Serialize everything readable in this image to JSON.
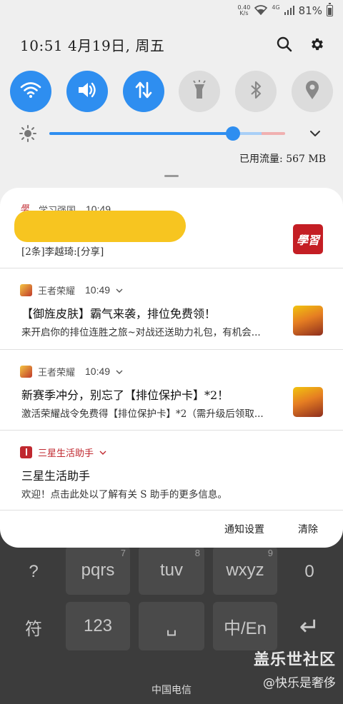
{
  "status_bar": {
    "net_speed_value": "0.40",
    "net_speed_unit": "K/s",
    "network_type": "4G",
    "battery_text": "81%"
  },
  "header": {
    "time_date": "10:51  4月19日, 周五"
  },
  "quick_toggles": [
    {
      "name": "wifi-toggle",
      "icon": "wifi-icon",
      "state": "on"
    },
    {
      "name": "sound-toggle",
      "icon": "speaker-icon",
      "state": "on"
    },
    {
      "name": "mobile-data-toggle",
      "icon": "data-arrows-icon",
      "state": "on"
    },
    {
      "name": "flashlight-toggle",
      "icon": "flashlight-icon",
      "state": "off"
    },
    {
      "name": "bluetooth-toggle",
      "icon": "bluetooth-icon",
      "state": "off"
    },
    {
      "name": "location-toggle",
      "icon": "location-pin-icon",
      "state": "off"
    }
  ],
  "brightness": {
    "level": 0.78
  },
  "data_usage": "已用流量: 567 MB",
  "notifications": [
    {
      "app_name": "学习强国",
      "time": "10:49",
      "title": "",
      "body": "[2条]李越琦:[分享]"
    },
    {
      "app_name": "王者荣耀",
      "time": "10:49",
      "title": "【御旌皮肤】霸气来袭，排位免费领！",
      "body": "来开启你的排位连胜之旅~对战还送助力礼包，有机会..."
    },
    {
      "app_name": "王者荣耀",
      "time": "10:49",
      "title": "新赛季冲分，别忘了【排位保护卡】*2！",
      "body": "激活荣耀战令免费得【排位保护卡】*2（需升级后领取..."
    },
    {
      "app_name": "三星生活助手",
      "time": "",
      "title": "三星生活助手",
      "body": "欢迎！点击此处以了解有关 S 助手的更多信息。"
    }
  ],
  "card_actions": {
    "settings_label": "通知设置",
    "clear_label": "清除"
  },
  "keyboard": {
    "row1": [
      {
        "label": "?",
        "num": ""
      },
      {
        "label": "pqrs",
        "num": "7"
      },
      {
        "label": "tuv",
        "num": "8"
      },
      {
        "label": "wxyz",
        "num": "9"
      },
      {
        "label": "0",
        "num": ""
      }
    ],
    "row2": [
      {
        "label": "符",
        "num": ""
      },
      {
        "label": "123",
        "num": ""
      },
      {
        "label": "␣",
        "num": ""
      },
      {
        "label": "中/En",
        "num": ""
      },
      {
        "label": "↵",
        "num": ""
      }
    ]
  },
  "carrier": "中国电信",
  "watermark": {
    "title": "盖乐世社区",
    "subtitle": "@快乐是奢侈"
  },
  "colors": {
    "accent": "#2e8ef0",
    "panel_bg": "#efefef",
    "card_bg": "#ffffff",
    "samsung_red": "#c0282f"
  }
}
